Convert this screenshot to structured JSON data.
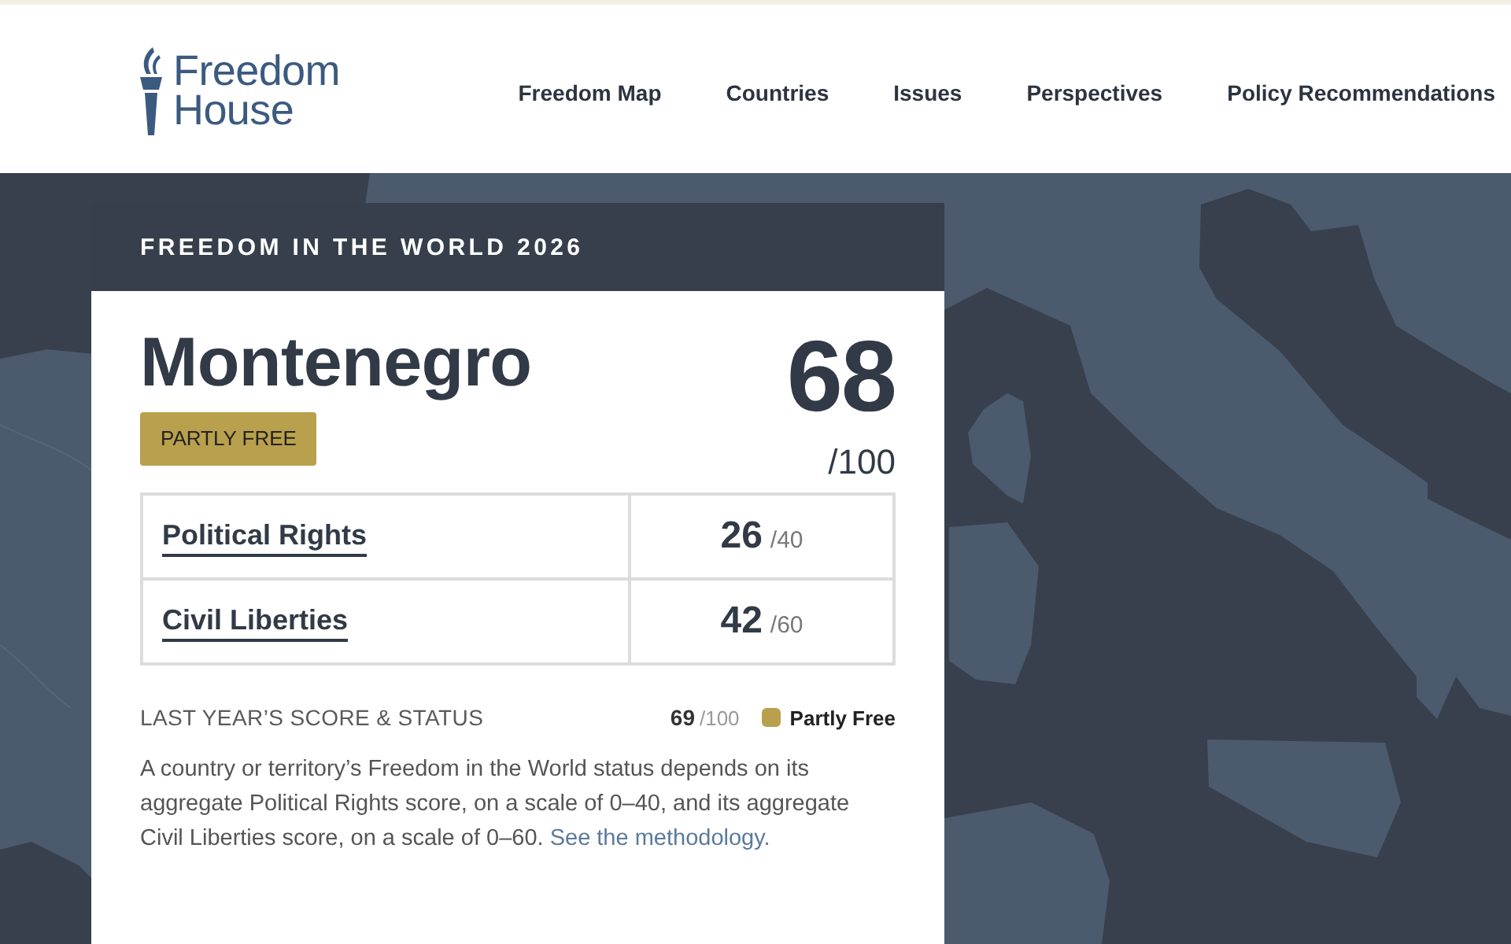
{
  "header": {
    "logo": {
      "text": "Freedom House"
    },
    "nav": [
      {
        "label": "Freedom Map"
      },
      {
        "label": "Countries"
      },
      {
        "label": "Issues"
      },
      {
        "label": "Perspectives"
      },
      {
        "label": "Policy Recommendations"
      }
    ]
  },
  "report": {
    "title": "FREEDOM IN THE WORLD 2026",
    "country": "Montenegro",
    "status": "PARTLY FREE",
    "score": "68",
    "score_max": "/100",
    "categories": [
      {
        "name": "Political Rights",
        "score": "26",
        "max": "/40"
      },
      {
        "name": "Civil Liberties",
        "score": "42",
        "max": "/60"
      }
    ],
    "last_year": {
      "heading": "LAST YEAR’S SCORE & STATUS",
      "score": "69",
      "max": "/100",
      "status": "Partly Free"
    },
    "description": {
      "text": "A country or territory’s Freedom in the World status depends on its aggregate Political Rights score, on a scale of 0–40, and its aggregate Civil Liberties score, on a scale of 0–60.",
      "link": "See the methodology."
    }
  }
}
